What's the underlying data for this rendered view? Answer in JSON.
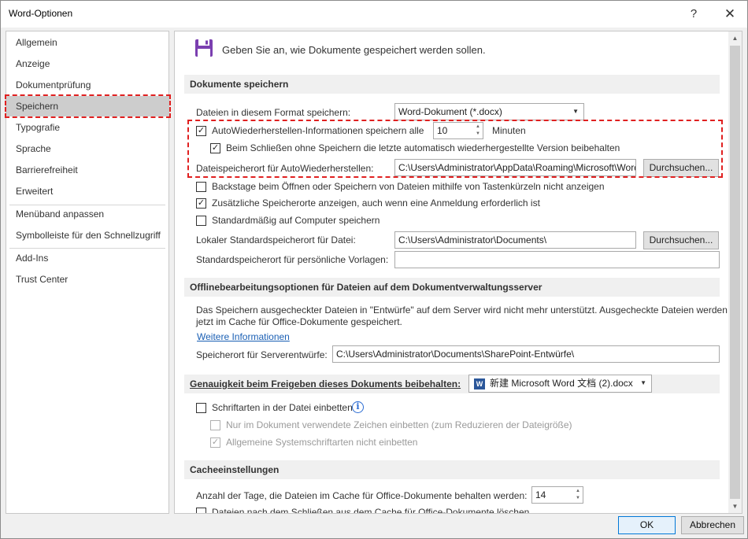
{
  "window": {
    "title": "Word-Optionen",
    "help_glyph": "?",
    "close_glyph": "✕"
  },
  "sidebar": {
    "items": [
      {
        "label": "Allgemein"
      },
      {
        "label": "Anzeige"
      },
      {
        "label": "Dokumentprüfung"
      },
      {
        "label": "Speichern",
        "selected": true
      },
      {
        "label": "Typografie"
      },
      {
        "label": "Sprache"
      },
      {
        "label": "Barrierefreiheit"
      },
      {
        "label": "Erweitert"
      },
      {
        "label": "Menüband anpassen"
      },
      {
        "label": "Symbolleiste für den Schnellzugriff"
      },
      {
        "label": "Add-Ins"
      },
      {
        "label": "Trust Center"
      }
    ]
  },
  "header": {
    "icon": "floppy-save-icon",
    "text": "Geben Sie an, wie Dokumente gespeichert werden sollen."
  },
  "save_docs": {
    "title": "Dokumente speichern",
    "format_label": "Dateien in diesem Format speichern:",
    "format_value": "Word-Dokument (*.docx)",
    "autorecover_label": "AutoWiederherstellen-Informationen speichern alle",
    "autorecover_checked": true,
    "autorecover_minutes": "10",
    "minutes_label": "Minuten",
    "keep_last_label": "Beim Schließen ohne Speichern die letzte automatisch wiederhergestellte Version beibehalten",
    "keep_last_checked": true,
    "autorecover_location_label": "Dateispeicherort für AutoWiederherstellen:",
    "autorecover_location_value": "C:\\Users\\Administrator\\AppData\\Roaming\\Microsoft\\Word\\",
    "browse_label": "Durchsuchen...",
    "backstage_label": "Backstage beim Öffnen oder Speichern von Dateien mithilfe von Tastenkürzeln nicht anzeigen",
    "backstage_checked": false,
    "additional_locations_label": "Zusätzliche Speicherorte anzeigen, auch wenn eine Anmeldung erforderlich ist",
    "additional_locations_checked": true,
    "default_computer_label": "Standardmäßig auf Computer speichern",
    "default_computer_checked": false,
    "local_default_label": "Lokaler Standardspeicherort für Datei:",
    "local_default_value": "C:\\Users\\Administrator\\Documents\\",
    "browse2_label": "Durchsuchen...",
    "templates_label": "Standardspeicherort für persönliche Vorlagen:",
    "templates_value": ""
  },
  "offline": {
    "title": "Offlinebearbeitungsoptionen für Dateien auf dem Dokumentverwaltungsserver",
    "info_line1": "Das Speichern ausgecheckter Dateien in \"Entwürfe\" auf dem Server wird nicht mehr unterstützt. Ausgecheckte Dateien werden",
    "info_line2": "jetzt im Cache für Office-Dokumente gespeichert.",
    "more_info_link": "Weitere Informationen",
    "server_drafts_label": "Speicherort für Serverentwürfe:",
    "server_drafts_value": "C:\\Users\\Administrator\\Documents\\SharePoint-Entwürfe\\"
  },
  "fidelity": {
    "title": "Genauigkeit beim Freigeben dieses Dokuments beibehalten:",
    "document_value": "新建 Microsoft Word 文档 (2).docx",
    "embed_fonts_label": "Schriftarten in der Datei einbetten",
    "embed_fonts_checked": false,
    "only_used_label": "Nur im Dokument verwendete Zeichen einbetten (zum Reduzieren der Dateigröße)",
    "only_used_checked": false,
    "no_system_label": "Allgemeine Systemschriftarten nicht einbetten",
    "no_system_checked": true
  },
  "cache": {
    "title": "Cacheeinstellungen",
    "days_label": "Anzahl der Tage, die Dateien im Cache für Office-Dokumente behalten werden:",
    "days_value": "14",
    "delete_label": "Dateien nach dem Schließen aus dem Cache für Office-Dokumente löschen"
  },
  "footer": {
    "ok_label": "OK",
    "cancel_label": "Abbrechen"
  },
  "colors": {
    "highlight_dashes": "#e02020",
    "selected_nav": "#cdcdcd",
    "section_bg": "#f0f0f0",
    "link": "#1a5fb4"
  }
}
